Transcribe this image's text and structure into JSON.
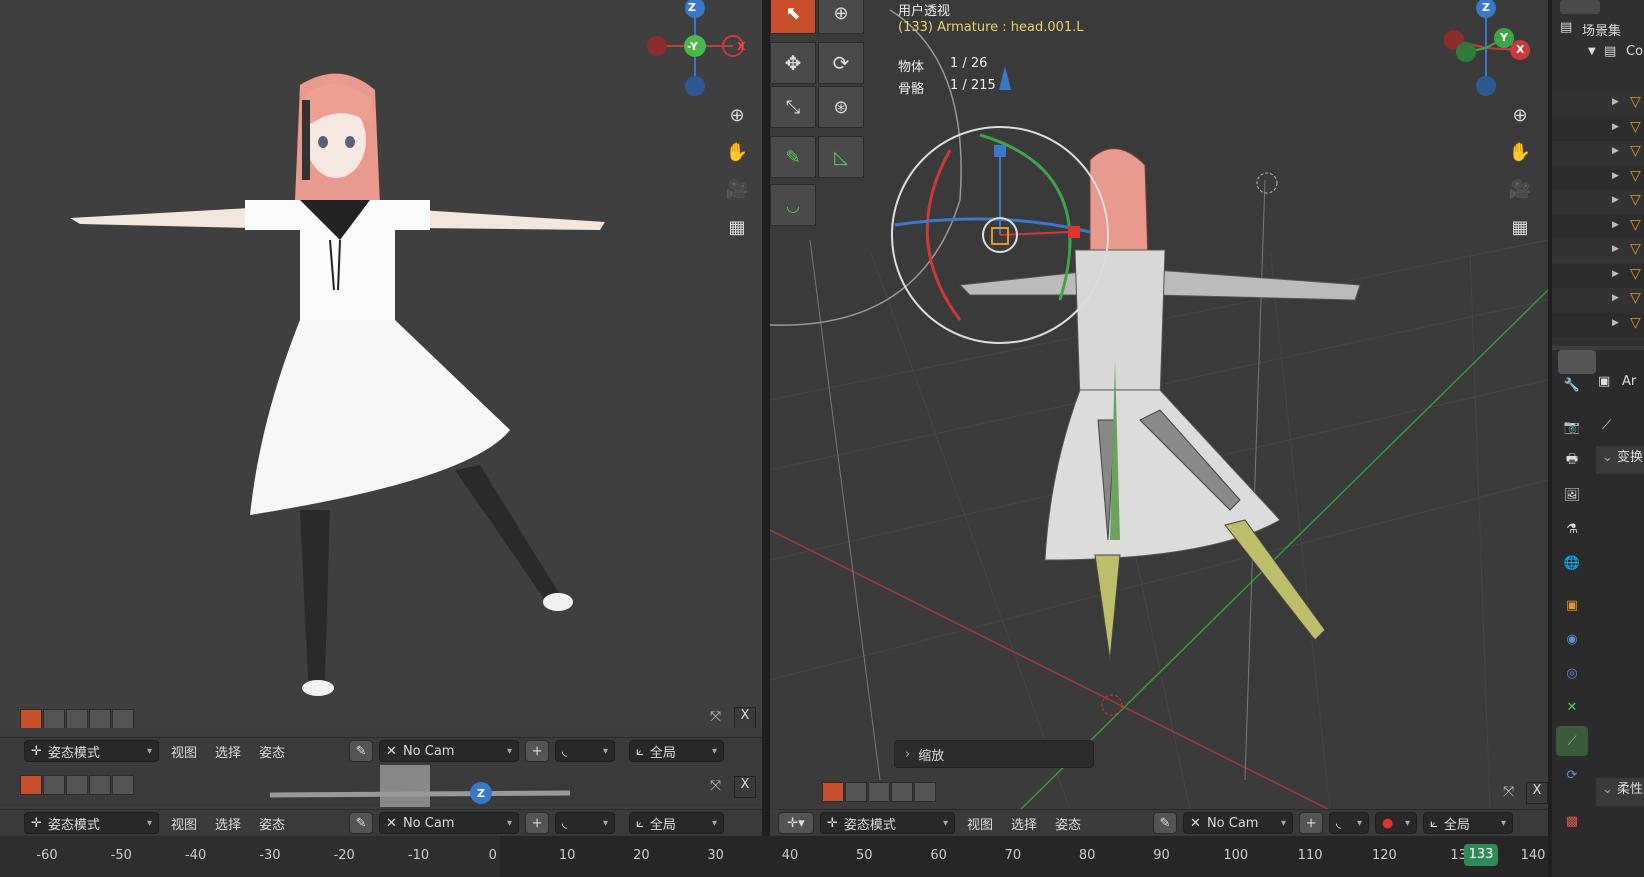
{
  "left_viewport": {
    "mode": "姿态模式",
    "menus": [
      "视图",
      "选择",
      "姿态"
    ],
    "camera": "No Cam",
    "scope": "全局",
    "gizmo": {
      "z": "Z",
      "y": "-Y",
      "x": "X"
    }
  },
  "right_viewport": {
    "view_name": "用户透视",
    "selection_info": "(133) Armature : head.001.L",
    "stats": [
      {
        "label": "物体",
        "value": "1 / 26"
      },
      {
        "label": "骨骼",
        "value": "1 / 215"
      }
    ],
    "mode": "姿态模式",
    "menus": [
      "视图",
      "选择",
      "姿态"
    ],
    "camera": "No Cam",
    "scope": "全局",
    "gizmo": {
      "z": "Z",
      "y": "Y",
      "x": "X"
    },
    "operator_panel": "缩放"
  },
  "middle_header": {
    "mode": "姿态模式",
    "menus": [
      "视图",
      "选择",
      "姿态"
    ],
    "camera": "No Cam",
    "scope": "全局",
    "gizmo_z": "Z"
  },
  "timeline": {
    "ticks": [
      "-60",
      "-50",
      "-40",
      "-30",
      "-20",
      "-10",
      "0",
      "10",
      "20",
      "30",
      "40",
      "50",
      "60",
      "70",
      "80",
      "90",
      "100",
      "110",
      "120",
      "13",
      "140"
    ],
    "current_frame": "133"
  },
  "outliner": {
    "title": "场景集",
    "collection": "Co"
  },
  "properties": {
    "object_label": "Ar",
    "section_transform": "变换",
    "section_soft": "柔性"
  },
  "colors": {
    "accent": "#c8502a",
    "current_frame": "#2e8b57",
    "selection_text": "#e6d36a"
  }
}
